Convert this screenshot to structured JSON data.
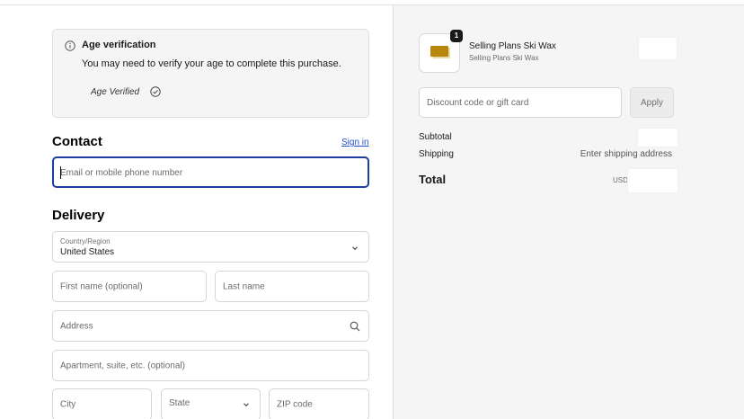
{
  "age_verification": {
    "title": "Age verification",
    "description": "You may need to verify your age to complete this purchase.",
    "status": "Age Verified"
  },
  "contact": {
    "title": "Contact",
    "sign_in": "Sign in",
    "email_placeholder": "Email or mobile phone number"
  },
  "delivery": {
    "title": "Delivery",
    "country_label": "Country/Region",
    "country_value": "United States",
    "first_name_placeholder": "First name (optional)",
    "last_name_placeholder": "Last name",
    "address_placeholder": "Address",
    "apartment_placeholder": "Apartment, suite, etc. (optional)",
    "city_placeholder": "City",
    "state_placeholder": "State",
    "zip_placeholder": "ZIP code"
  },
  "order_summary": {
    "product": {
      "quantity": "1",
      "name": "Selling Plans Ski Wax",
      "variant": "Selling Plans Ski Wax"
    },
    "discount_placeholder": "Discount code or gift card",
    "apply_label": "Apply",
    "subtotal_label": "Subtotal",
    "shipping_label": "Shipping",
    "shipping_value": "Enter shipping address",
    "total_label": "Total",
    "currency": "USD"
  },
  "icons": {
    "info": "info-icon",
    "check": "check-circle-icon",
    "chevron": "chevron-down-icon",
    "search": "search-icon"
  },
  "colors": {
    "link": "#1f4fc7",
    "focus_border": "#1f3f9e",
    "summary_bg": "#f5f5f5"
  }
}
